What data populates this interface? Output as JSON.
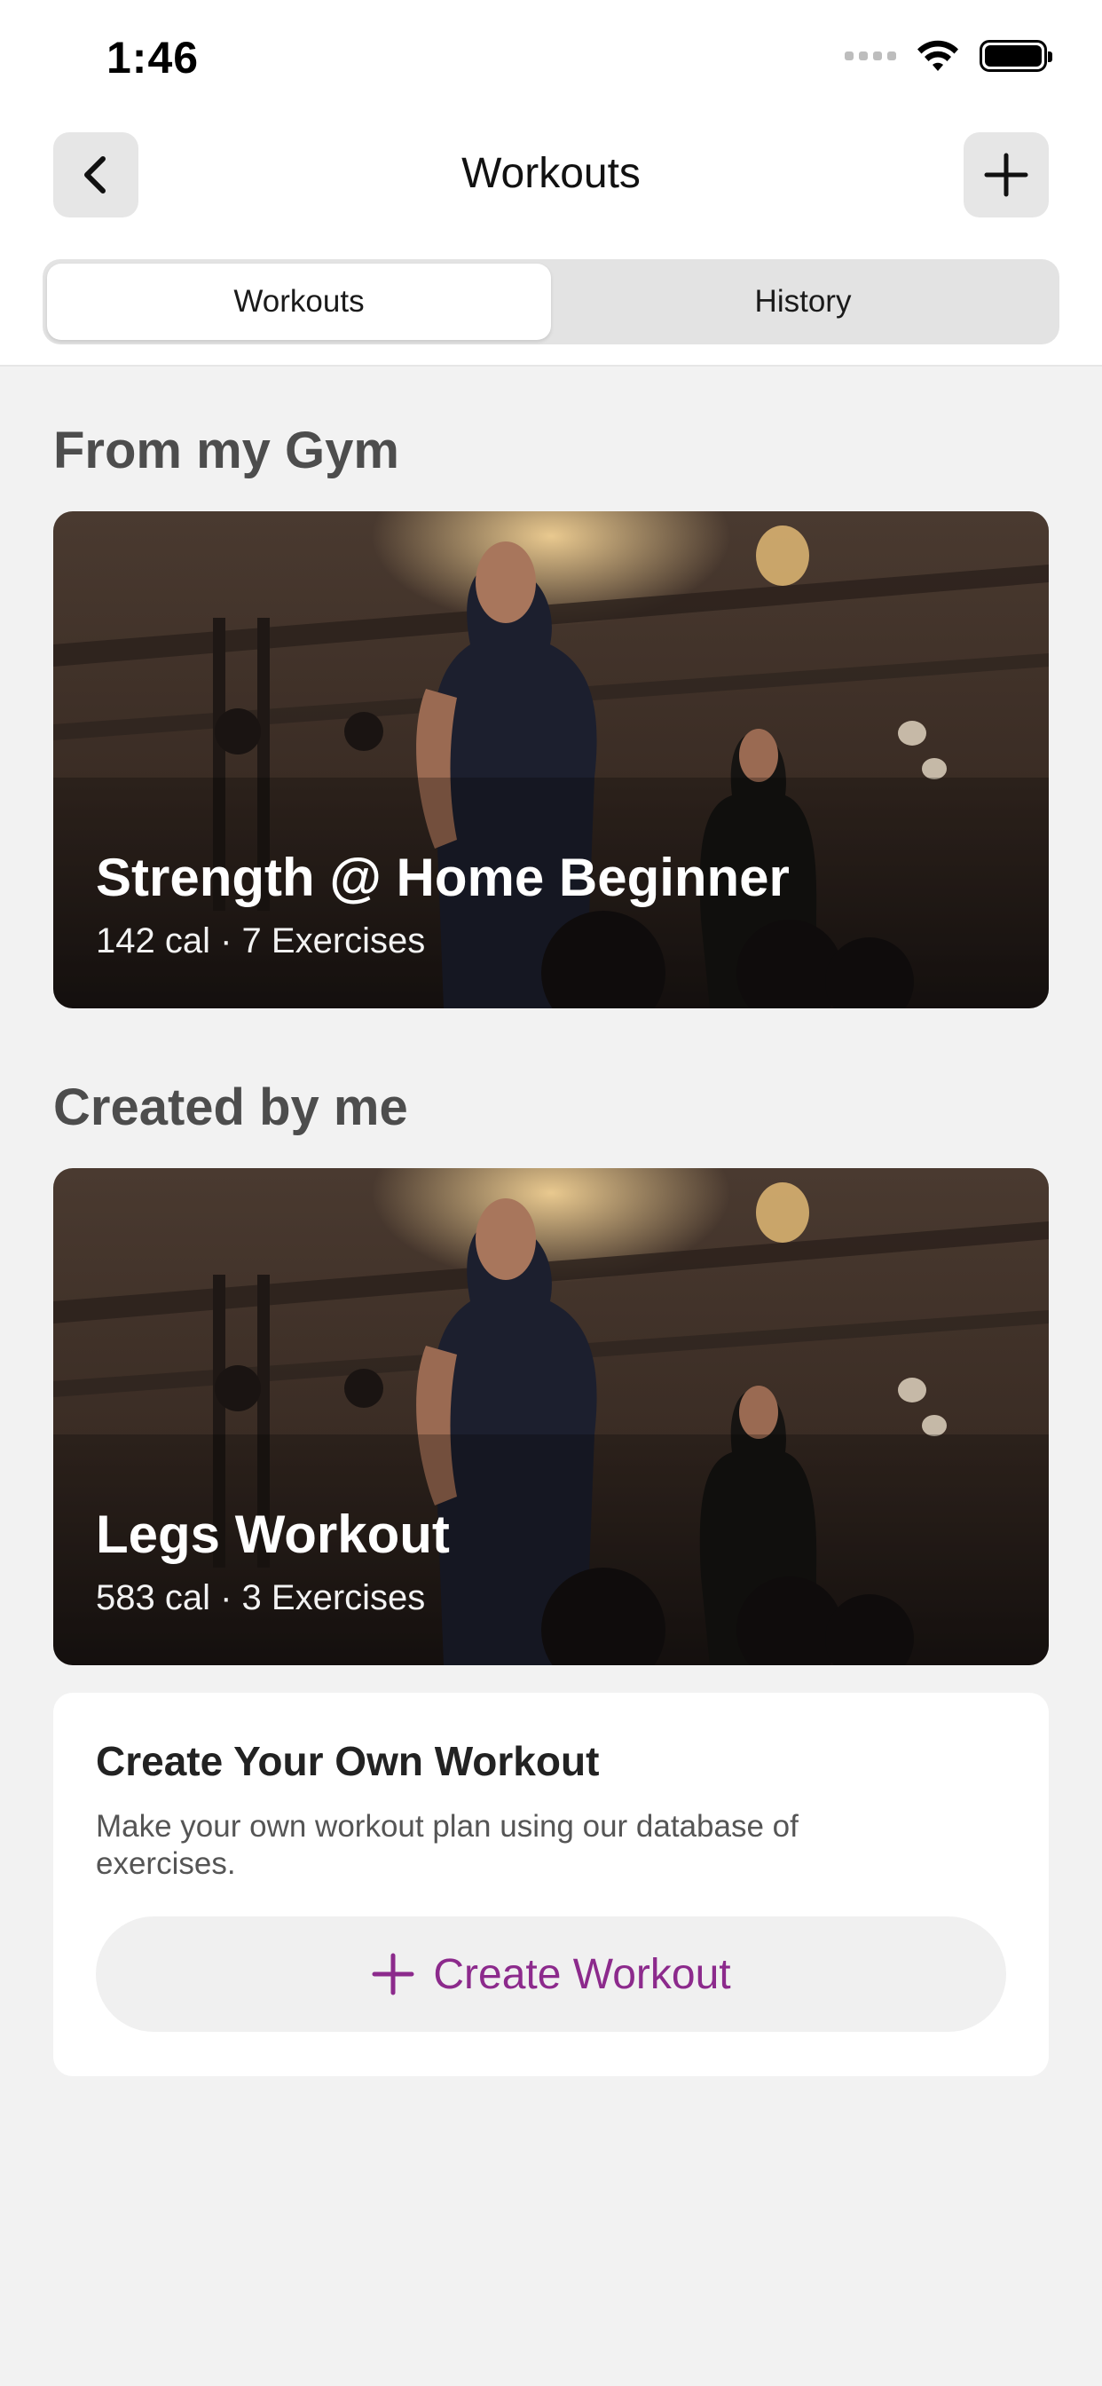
{
  "status_bar": {
    "time": "1:46"
  },
  "nav": {
    "title": "Workouts"
  },
  "segments": [
    {
      "label": "Workouts",
      "active": true
    },
    {
      "label": "History",
      "active": false
    }
  ],
  "sections": {
    "gym": {
      "title": "From my Gym",
      "card": {
        "title": "Strength @ Home Beginner",
        "subtitle": "142 cal · 7 Exercises"
      }
    },
    "mine": {
      "title": "Created by me",
      "card": {
        "title": "Legs Workout",
        "subtitle": "583 cal · 3 Exercises"
      }
    }
  },
  "create": {
    "title": "Create Your Own Workout",
    "description": "Make your own workout plan using our database of exercises.",
    "button_label": "Create Workout"
  },
  "colors": {
    "accent": "#8c2a8c",
    "background": "#f2f2f2",
    "segment_bg": "#e3e3e3"
  },
  "icons": [
    "chevron-left-icon",
    "plus-icon",
    "wifi-icon",
    "battery-icon",
    "signal-icon"
  ]
}
